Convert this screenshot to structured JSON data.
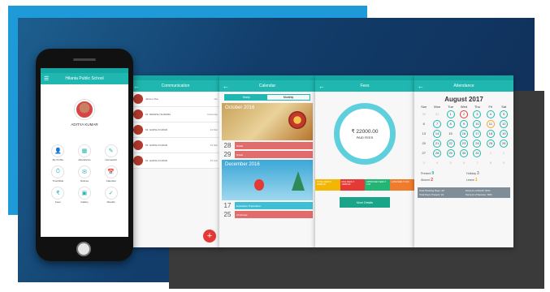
{
  "phone": {
    "school_name": "Hilanta Public School",
    "student_name": "ADITYA KUMAR",
    "tiles": [
      {
        "icon": "person-icon",
        "glyph": "👤",
        "label": "My Profile"
      },
      {
        "icon": "attendance-icon",
        "glyph": "▦",
        "label": "Attendance"
      },
      {
        "icon": "homework-icon",
        "glyph": "✎",
        "label": "Homework"
      },
      {
        "icon": "timetable-icon",
        "glyph": "⏱",
        "label": "TimeTable"
      },
      {
        "icon": "notice-icon",
        "glyph": "✉",
        "label": "Notices"
      },
      {
        "icon": "calendar-icon",
        "glyph": "📅",
        "label": "Calendar"
      },
      {
        "icon": "fees-icon",
        "glyph": "₹",
        "label": "Fees"
      },
      {
        "icon": "gallery-icon",
        "glyph": "▣",
        "label": "Gallery"
      },
      {
        "icon": "results-icon",
        "glyph": "✓",
        "label": "Results"
      }
    ]
  },
  "timetable": {
    "title": "Communication",
    "rows": [
      {
        "text": "Jammu Jha",
        "day": "Jan"
      },
      {
        "text": "Mr. DENESH SHARMA",
        "day": "Yesterday"
      },
      {
        "text": "Mr. HARSH KUMAR",
        "day": "13 Mar"
      },
      {
        "text": "Mr. HARSH KUMAR",
        "day": "09 Mar"
      },
      {
        "text": "Mr. HARSH KUMAR",
        "day": "25 Feb"
      }
    ],
    "fab_label": "+"
  },
  "calendar": {
    "title": "Calendar",
    "tabs": [
      "Yearly",
      "Monthly"
    ],
    "month1": "October 2016",
    "month2": "December 2016",
    "events1": [
      {
        "num": "28",
        "label": "Diwali",
        "color": "#e26b6b"
      },
      {
        "num": "29",
        "label": "Diwali",
        "color": "#e26b6b"
      }
    ],
    "events2": [
      {
        "num": "17",
        "label": "Evaluation Preparation",
        "color": "#3fbfd3"
      },
      {
        "num": "25",
        "label": "Christmas",
        "color": "#e26b6b"
      }
    ]
  },
  "fees": {
    "title": "Fees",
    "amount": "22000.00",
    "paid_label": "PAID FEES",
    "rows": [
      {
        "text": "TOTAL FEES ₹ 32000.00",
        "color": "#f2b705"
      },
      {
        "text": "DUE FEES ₹ 10000.00",
        "color": "#e53935"
      },
      {
        "text": "APPROVED FEES ₹ 0.00",
        "color": "#22b573"
      },
      {
        "text": "LATE FEES ₹ 0.00",
        "color": "#f07b2c"
      }
    ],
    "more_label": "More Details"
  },
  "attendance": {
    "title": "Attendance",
    "month": "August 2017",
    "weekdays": [
      "Sun",
      "Mon",
      "Tue",
      "Wed",
      "Thu",
      "Fri",
      "Sat"
    ],
    "days": [
      {
        "n": "30",
        "s": "g"
      },
      {
        "n": "31",
        "s": "g"
      },
      {
        "n": "1",
        "s": "p"
      },
      {
        "n": "2",
        "s": "a"
      },
      {
        "n": "3",
        "s": "p"
      },
      {
        "n": "4",
        "s": "p"
      },
      {
        "n": "5",
        "s": "p"
      },
      {
        "n": "6",
        "s": ""
      },
      {
        "n": "7",
        "s": "p"
      },
      {
        "n": "8",
        "s": "p"
      },
      {
        "n": "9",
        "s": "p"
      },
      {
        "n": "10",
        "s": "p"
      },
      {
        "n": "11",
        "s": "l"
      },
      {
        "n": "12",
        "s": "p"
      },
      {
        "n": "13",
        "s": ""
      },
      {
        "n": "14",
        "s": "p"
      },
      {
        "n": "15",
        "s": ""
      },
      {
        "n": "16",
        "s": "p"
      },
      {
        "n": "17",
        "s": "p"
      },
      {
        "n": "18",
        "s": "p"
      },
      {
        "n": "19",
        "s": "p"
      },
      {
        "n": "20",
        "s": ""
      },
      {
        "n": "21",
        "s": "p"
      },
      {
        "n": "22",
        "s": "p"
      },
      {
        "n": "23",
        "s": "p"
      },
      {
        "n": "24",
        "s": "p"
      },
      {
        "n": "25",
        "s": "p"
      },
      {
        "n": "26",
        "s": "p"
      },
      {
        "n": "27",
        "s": ""
      },
      {
        "n": "28",
        "s": "p"
      },
      {
        "n": "29",
        "s": "p"
      },
      {
        "n": "30",
        "s": "p"
      },
      {
        "n": "31",
        "s": "p"
      },
      {
        "n": "1",
        "s": "g"
      },
      {
        "n": "2",
        "s": "g"
      },
      {
        "n": "3",
        "s": "g"
      },
      {
        "n": "4",
        "s": "g"
      },
      {
        "n": "5",
        "s": "g"
      },
      {
        "n": "6",
        "s": "g"
      },
      {
        "n": "7",
        "s": "g"
      },
      {
        "n": "8",
        "s": "g"
      },
      {
        "n": "9",
        "s": "g"
      }
    ],
    "legend": [
      {
        "label": "Present",
        "value": "9",
        "color": "#1fb7b0"
      },
      {
        "label": "Holiday",
        "value": "3",
        "color": "#888"
      },
      {
        "label": "Absent",
        "value": "2",
        "color": "#e53935"
      },
      {
        "label": "Leave",
        "value": "1",
        "color": "#f5a623"
      }
    ],
    "summary": [
      "Total Working Days: 23",
      "Percent of Month: 82%",
      "Total Days Present: 19",
      "Percent of Session: 84%"
    ]
  }
}
